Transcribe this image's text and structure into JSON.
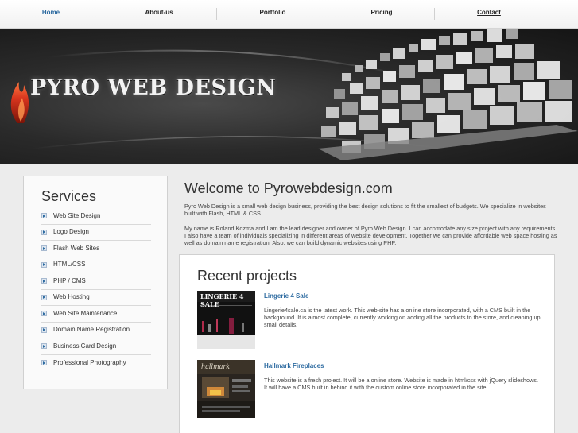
{
  "nav": {
    "items": [
      {
        "label": "Home"
      },
      {
        "label": "About-us"
      },
      {
        "label": "Portfolio"
      },
      {
        "label": "Pricing"
      },
      {
        "label": "Contact"
      }
    ]
  },
  "banner": {
    "title": "PYRO WEB DESIGN",
    "accent_color": "#d8351e"
  },
  "sidebar": {
    "title": "Services",
    "items": [
      {
        "label": "Web Site Design"
      },
      {
        "label": "Logo Design"
      },
      {
        "label": "Flash Web Sites"
      },
      {
        "label": "HTML/CSS"
      },
      {
        "label": "PHP / CMS"
      },
      {
        "label": "Web Hosting"
      },
      {
        "label": "Web Site Maintenance"
      },
      {
        "label": "Domain Name Registration"
      },
      {
        "label": "Business Card Design"
      },
      {
        "label": "Professional Photography"
      }
    ]
  },
  "main": {
    "welcome_title": "Welcome to Pyrowebdesign.com",
    "intro": "Pyro Web Design is a small web design business, providing the best design solutions to fit the smallest of budgets. We specialize in websites built with Flash, HTML & CSS.",
    "about": "My name is Roland Kozma and I am the lead designer and owner of Pyro Web Design. I can accomodate any size project with any requirements. I also have a team of individuals specializing in different areas of website development. Together we can provide affordable web space hosting as well as domain name registration. Also, we can build dynamic websites using PHP."
  },
  "recent": {
    "title": "Recent projects",
    "projects": [
      {
        "title": "Lingerie 4 Sale",
        "thumb_text": "LINGERIE 4 SALE",
        "description": "Lingerie4sale.ca is the latest work. This web-site has a online store incorporated, with a CMS built in the background. It is almost complete, currently working on adding all the products to the store, and cleaning up small details."
      },
      {
        "title": "Hallmark Fireplaces",
        "thumb_text": "hallmark",
        "description": "This website is a fresh project. It will be a online store. Website is made in html/css with jQuery slideshows. It will have a CMS built in behind it with the custom online store incorporated in the site."
      }
    ]
  },
  "colors": {
    "link": "#2c6aa0",
    "page_bg": "#ececec",
    "banner_bg": "#1e1e1e"
  }
}
